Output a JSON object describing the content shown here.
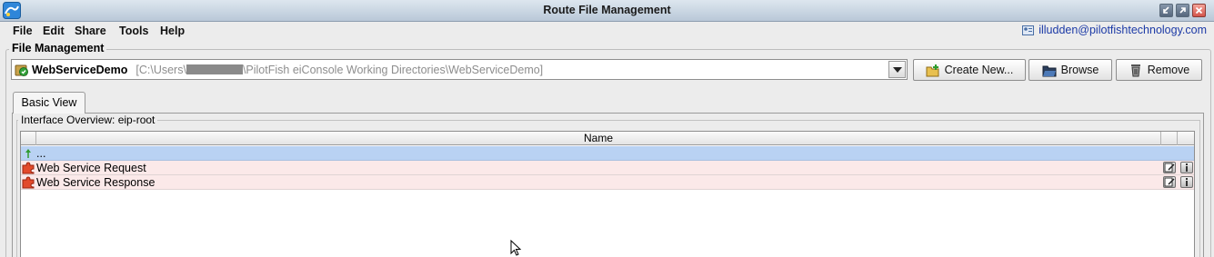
{
  "window": {
    "title": "Route File Management"
  },
  "menu": {
    "items": [
      "File",
      "Edit",
      "Share",
      "Tools",
      "Help"
    ],
    "user_email": "illudden@pilotfishtechnology.com"
  },
  "file_management": {
    "group_title": "File Management",
    "selected_project": {
      "name": "WebServiceDemo",
      "path_prefix": "[C:\\Users\\",
      "path_suffix": "\\PilotFish eiConsole Working Directories\\WebServiceDemo]"
    },
    "buttons": {
      "create_new": "Create New...",
      "browse": "Browse",
      "remove": "Remove"
    }
  },
  "tabs": [
    {
      "label": "Basic View",
      "active": true
    }
  ],
  "interface_overview": {
    "title": "Interface Overview: eip-root",
    "columns": {
      "name": "Name"
    },
    "rows": [
      {
        "name": "...",
        "type": "parent-folder"
      },
      {
        "name": "Web Service Request",
        "type": "route"
      },
      {
        "name": "Web Service Response",
        "type": "route"
      }
    ]
  },
  "colors": {
    "selected_row": "#b9d2f3",
    "route_row": "#fbe9e9",
    "email_link": "#1c3aa6"
  }
}
